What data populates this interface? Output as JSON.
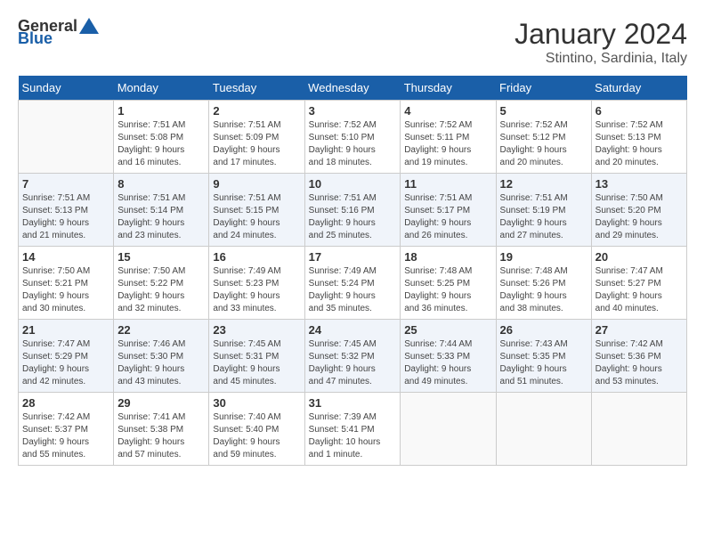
{
  "header": {
    "logo_general": "General",
    "logo_blue": "Blue",
    "month": "January 2024",
    "location": "Stintino, Sardinia, Italy"
  },
  "columns": [
    "Sunday",
    "Monday",
    "Tuesday",
    "Wednesday",
    "Thursday",
    "Friday",
    "Saturday"
  ],
  "weeks": [
    [
      {
        "day": "",
        "info": ""
      },
      {
        "day": "1",
        "info": "Sunrise: 7:51 AM\nSunset: 5:08 PM\nDaylight: 9 hours\nand 16 minutes."
      },
      {
        "day": "2",
        "info": "Sunrise: 7:51 AM\nSunset: 5:09 PM\nDaylight: 9 hours\nand 17 minutes."
      },
      {
        "day": "3",
        "info": "Sunrise: 7:52 AM\nSunset: 5:10 PM\nDaylight: 9 hours\nand 18 minutes."
      },
      {
        "day": "4",
        "info": "Sunrise: 7:52 AM\nSunset: 5:11 PM\nDaylight: 9 hours\nand 19 minutes."
      },
      {
        "day": "5",
        "info": "Sunrise: 7:52 AM\nSunset: 5:12 PM\nDaylight: 9 hours\nand 20 minutes."
      },
      {
        "day": "6",
        "info": "Sunrise: 7:52 AM\nSunset: 5:13 PM\nDaylight: 9 hours\nand 20 minutes."
      }
    ],
    [
      {
        "day": "7",
        "info": "Sunrise: 7:51 AM\nSunset: 5:13 PM\nDaylight: 9 hours\nand 21 minutes."
      },
      {
        "day": "8",
        "info": "Sunrise: 7:51 AM\nSunset: 5:14 PM\nDaylight: 9 hours\nand 23 minutes."
      },
      {
        "day": "9",
        "info": "Sunrise: 7:51 AM\nSunset: 5:15 PM\nDaylight: 9 hours\nand 24 minutes."
      },
      {
        "day": "10",
        "info": "Sunrise: 7:51 AM\nSunset: 5:16 PM\nDaylight: 9 hours\nand 25 minutes."
      },
      {
        "day": "11",
        "info": "Sunrise: 7:51 AM\nSunset: 5:17 PM\nDaylight: 9 hours\nand 26 minutes."
      },
      {
        "day": "12",
        "info": "Sunrise: 7:51 AM\nSunset: 5:19 PM\nDaylight: 9 hours\nand 27 minutes."
      },
      {
        "day": "13",
        "info": "Sunrise: 7:50 AM\nSunset: 5:20 PM\nDaylight: 9 hours\nand 29 minutes."
      }
    ],
    [
      {
        "day": "14",
        "info": "Sunrise: 7:50 AM\nSunset: 5:21 PM\nDaylight: 9 hours\nand 30 minutes."
      },
      {
        "day": "15",
        "info": "Sunrise: 7:50 AM\nSunset: 5:22 PM\nDaylight: 9 hours\nand 32 minutes."
      },
      {
        "day": "16",
        "info": "Sunrise: 7:49 AM\nSunset: 5:23 PM\nDaylight: 9 hours\nand 33 minutes."
      },
      {
        "day": "17",
        "info": "Sunrise: 7:49 AM\nSunset: 5:24 PM\nDaylight: 9 hours\nand 35 minutes."
      },
      {
        "day": "18",
        "info": "Sunrise: 7:48 AM\nSunset: 5:25 PM\nDaylight: 9 hours\nand 36 minutes."
      },
      {
        "day": "19",
        "info": "Sunrise: 7:48 AM\nSunset: 5:26 PM\nDaylight: 9 hours\nand 38 minutes."
      },
      {
        "day": "20",
        "info": "Sunrise: 7:47 AM\nSunset: 5:27 PM\nDaylight: 9 hours\nand 40 minutes."
      }
    ],
    [
      {
        "day": "21",
        "info": "Sunrise: 7:47 AM\nSunset: 5:29 PM\nDaylight: 9 hours\nand 42 minutes."
      },
      {
        "day": "22",
        "info": "Sunrise: 7:46 AM\nSunset: 5:30 PM\nDaylight: 9 hours\nand 43 minutes."
      },
      {
        "day": "23",
        "info": "Sunrise: 7:45 AM\nSunset: 5:31 PM\nDaylight: 9 hours\nand 45 minutes."
      },
      {
        "day": "24",
        "info": "Sunrise: 7:45 AM\nSunset: 5:32 PM\nDaylight: 9 hours\nand 47 minutes."
      },
      {
        "day": "25",
        "info": "Sunrise: 7:44 AM\nSunset: 5:33 PM\nDaylight: 9 hours\nand 49 minutes."
      },
      {
        "day": "26",
        "info": "Sunrise: 7:43 AM\nSunset: 5:35 PM\nDaylight: 9 hours\nand 51 minutes."
      },
      {
        "day": "27",
        "info": "Sunrise: 7:42 AM\nSunset: 5:36 PM\nDaylight: 9 hours\nand 53 minutes."
      }
    ],
    [
      {
        "day": "28",
        "info": "Sunrise: 7:42 AM\nSunset: 5:37 PM\nDaylight: 9 hours\nand 55 minutes."
      },
      {
        "day": "29",
        "info": "Sunrise: 7:41 AM\nSunset: 5:38 PM\nDaylight: 9 hours\nand 57 minutes."
      },
      {
        "day": "30",
        "info": "Sunrise: 7:40 AM\nSunset: 5:40 PM\nDaylight: 9 hours\nand 59 minutes."
      },
      {
        "day": "31",
        "info": "Sunrise: 7:39 AM\nSunset: 5:41 PM\nDaylight: 10 hours\nand 1 minute."
      },
      {
        "day": "",
        "info": ""
      },
      {
        "day": "",
        "info": ""
      },
      {
        "day": "",
        "info": ""
      }
    ]
  ]
}
